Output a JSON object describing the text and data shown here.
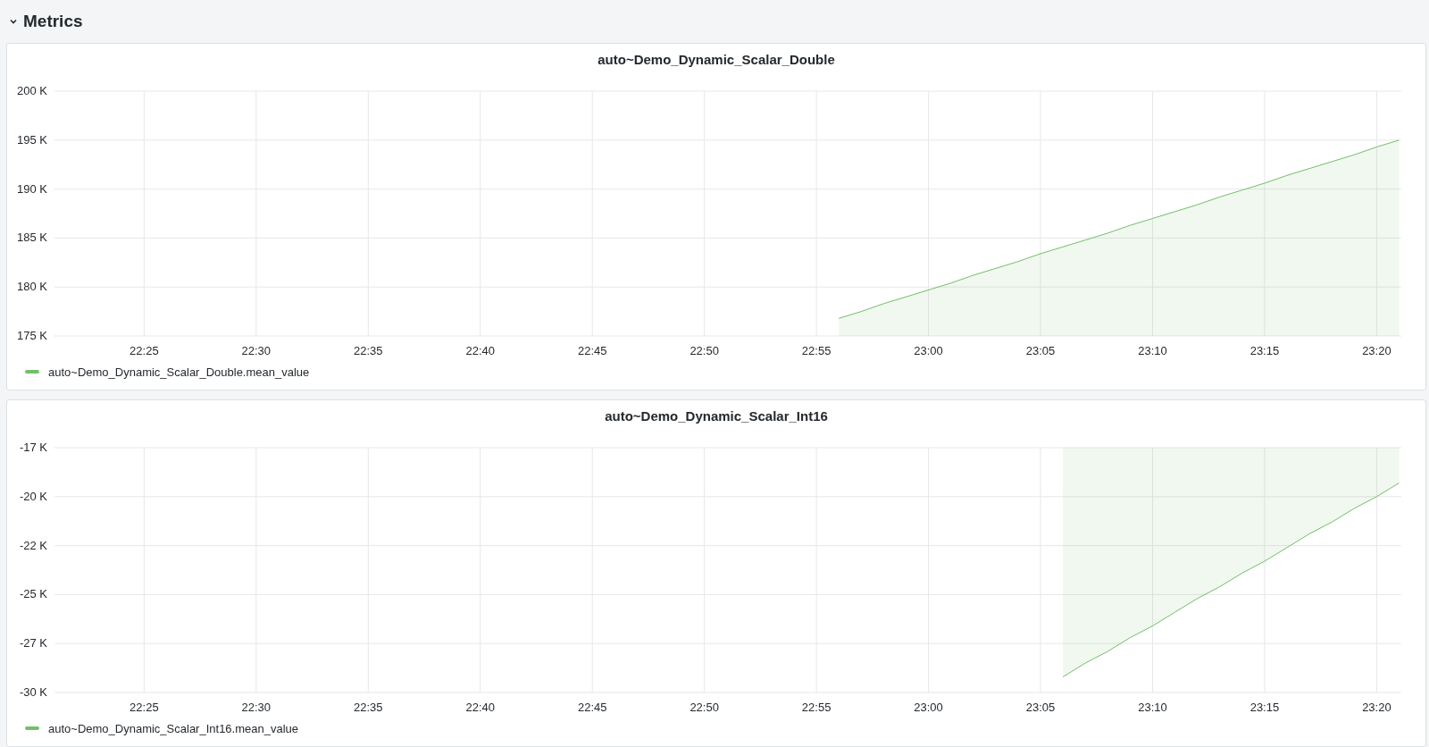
{
  "row": {
    "title": "Metrics",
    "expanded": true
  },
  "panels": [
    {
      "title": "auto~Demo_Dynamic_Scalar_Double",
      "chart_data": {
        "type": "area",
        "categories": [
          null,
          null,
          null,
          null,
          "22:25",
          null,
          null,
          null,
          null,
          "22:30",
          null,
          null,
          null,
          null,
          "22:35",
          null,
          null,
          null,
          null,
          "22:40",
          null,
          null,
          null,
          null,
          "22:45",
          null,
          null,
          null,
          null,
          "22:50",
          null,
          null,
          null,
          null,
          "22:55",
          null,
          null,
          null,
          null,
          "23:00",
          null,
          null,
          null,
          null,
          "23:05",
          null,
          null,
          null,
          null,
          "23:10",
          null,
          null,
          null,
          null,
          "23:15",
          null,
          null,
          null,
          null,
          "23:20",
          null
        ],
        "series": [
          {
            "name": "auto~Demo_Dynamic_Scalar_Double.mean_value",
            "color": "#73bf69",
            "values": [
              null,
              null,
              null,
              null,
              null,
              null,
              null,
              null,
              null,
              null,
              null,
              null,
              null,
              null,
              null,
              null,
              null,
              null,
              null,
              null,
              null,
              null,
              null,
              null,
              null,
              null,
              null,
              null,
              null,
              null,
              null,
              null,
              null,
              null,
              null,
              176800,
              177500,
              178300,
              179000,
              179700,
              180400,
              181200,
              181900,
              182600,
              183400,
              184100,
              184800,
              185500,
              186300,
              187000,
              187700,
              188400,
              189200,
              189900,
              190600,
              191400,
              192100,
              192800,
              193500,
              194300,
              195000
            ]
          }
        ],
        "grid": true,
        "ylim": [
          175000,
          200000
        ],
        "yticks": [
          {
            "value": 175000,
            "label": "175 K"
          },
          {
            "value": 180000,
            "label": "180 K"
          },
          {
            "value": 185000,
            "label": "185 K"
          },
          {
            "value": 190000,
            "label": "190 K"
          },
          {
            "value": 195000,
            "label": "195 K"
          },
          {
            "value": 200000,
            "label": "200 K"
          }
        ]
      }
    },
    {
      "title": "auto~Demo_Dynamic_Scalar_Int16",
      "chart_data": {
        "type": "area",
        "categories": [
          null,
          null,
          null,
          null,
          "22:25",
          null,
          null,
          null,
          null,
          "22:30",
          null,
          null,
          null,
          null,
          "22:35",
          null,
          null,
          null,
          null,
          "22:40",
          null,
          null,
          null,
          null,
          "22:45",
          null,
          null,
          null,
          null,
          "22:50",
          null,
          null,
          null,
          null,
          "22:55",
          null,
          null,
          null,
          null,
          "23:00",
          null,
          null,
          null,
          null,
          "23:05",
          null,
          null,
          null,
          null,
          "23:10",
          null,
          null,
          null,
          null,
          "23:15",
          null,
          null,
          null,
          null,
          "23:20",
          null
        ],
        "series": [
          {
            "name": "auto~Demo_Dynamic_Scalar_Int16.mean_value",
            "color": "#73bf69",
            "values": [
              null,
              null,
              null,
              null,
              null,
              null,
              null,
              null,
              null,
              null,
              null,
              null,
              null,
              null,
              null,
              null,
              null,
              null,
              null,
              null,
              null,
              null,
              null,
              null,
              null,
              null,
              null,
              null,
              null,
              null,
              null,
              null,
              null,
              null,
              null,
              null,
              null,
              null,
              null,
              null,
              null,
              null,
              null,
              null,
              null,
              -29200,
              -28500,
              -27900,
              -27200,
              -26600,
              -25900,
              -25200,
              -24600,
              -23900,
              -23300,
              -22600,
              -21900,
              -21300,
              -20600,
              -20000,
              -19300
            ]
          }
        ],
        "grid": true,
        "ylim": [
          -30000,
          -17500
        ],
        "yticks": [
          {
            "value": -30000,
            "label": "-30 K"
          },
          {
            "value": -27500,
            "label": "-27 K"
          },
          {
            "value": -25000,
            "label": "-25 K"
          },
          {
            "value": -22500,
            "label": "-22 K"
          },
          {
            "value": -20000,
            "label": "-20 K"
          },
          {
            "value": -17500,
            "label": "-17 K"
          }
        ]
      }
    }
  ]
}
